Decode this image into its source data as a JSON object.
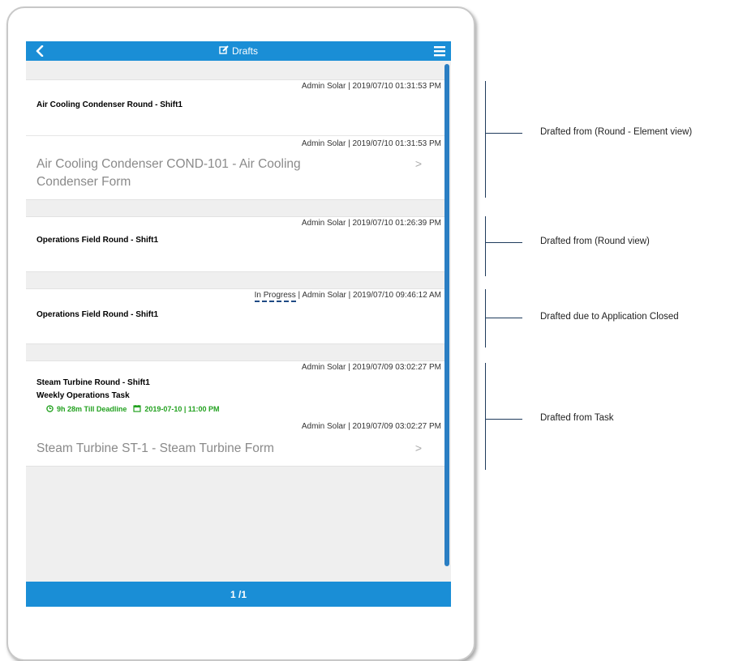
{
  "header": {
    "title": "Drafts",
    "edit_icon": "edit-icon",
    "back_icon": "chevron-left-icon",
    "menu_icon": "hamburger-menu-icon"
  },
  "drafts": [
    {
      "meta": "Admin Solar | 2019/07/10 01:31:53 PM",
      "title": "Air Cooling Condenser Round - Shift1",
      "element": {
        "meta": "Admin Solar | 2019/07/10 01:31:53 PM",
        "title_line1": "Air Cooling Condenser COND-101 - Air Cooling",
        "title_line2": "Condenser Form",
        "chevron": ">"
      }
    },
    {
      "meta": "Admin Solar | 2019/07/10 01:26:39 PM",
      "title": "Operations Field Round - Shift1"
    },
    {
      "status": "In Progress",
      "meta_rest": " | Admin Solar | 2019/07/10 09:46:12 AM",
      "title": "Operations Field Round - Shift1"
    },
    {
      "meta": "Admin Solar | 2019/07/09 03:02:27 PM",
      "title": "Steam Turbine Round - Shift1",
      "task": "Weekly Operations Task",
      "deadline": "9h 28m Till Deadline",
      "due": "2019-07-10 | 11:00 PM",
      "element": {
        "meta": "Admin Solar | 2019/07/09 03:02:27 PM",
        "title_line1": "Steam Turbine ST-1 - Steam Turbine Form",
        "chevron": ">"
      }
    }
  ],
  "footer": {
    "pagination": "1 /1"
  },
  "annotations": [
    "Drafted from  (Round - Element view)",
    "Drafted from  (Round view)",
    "Drafted due to Application Closed",
    "Drafted from Task"
  ],
  "colors": {
    "bar": "#1a8ed6",
    "deadline": "#22a11f",
    "annotation_line": "#1f3b5c"
  }
}
